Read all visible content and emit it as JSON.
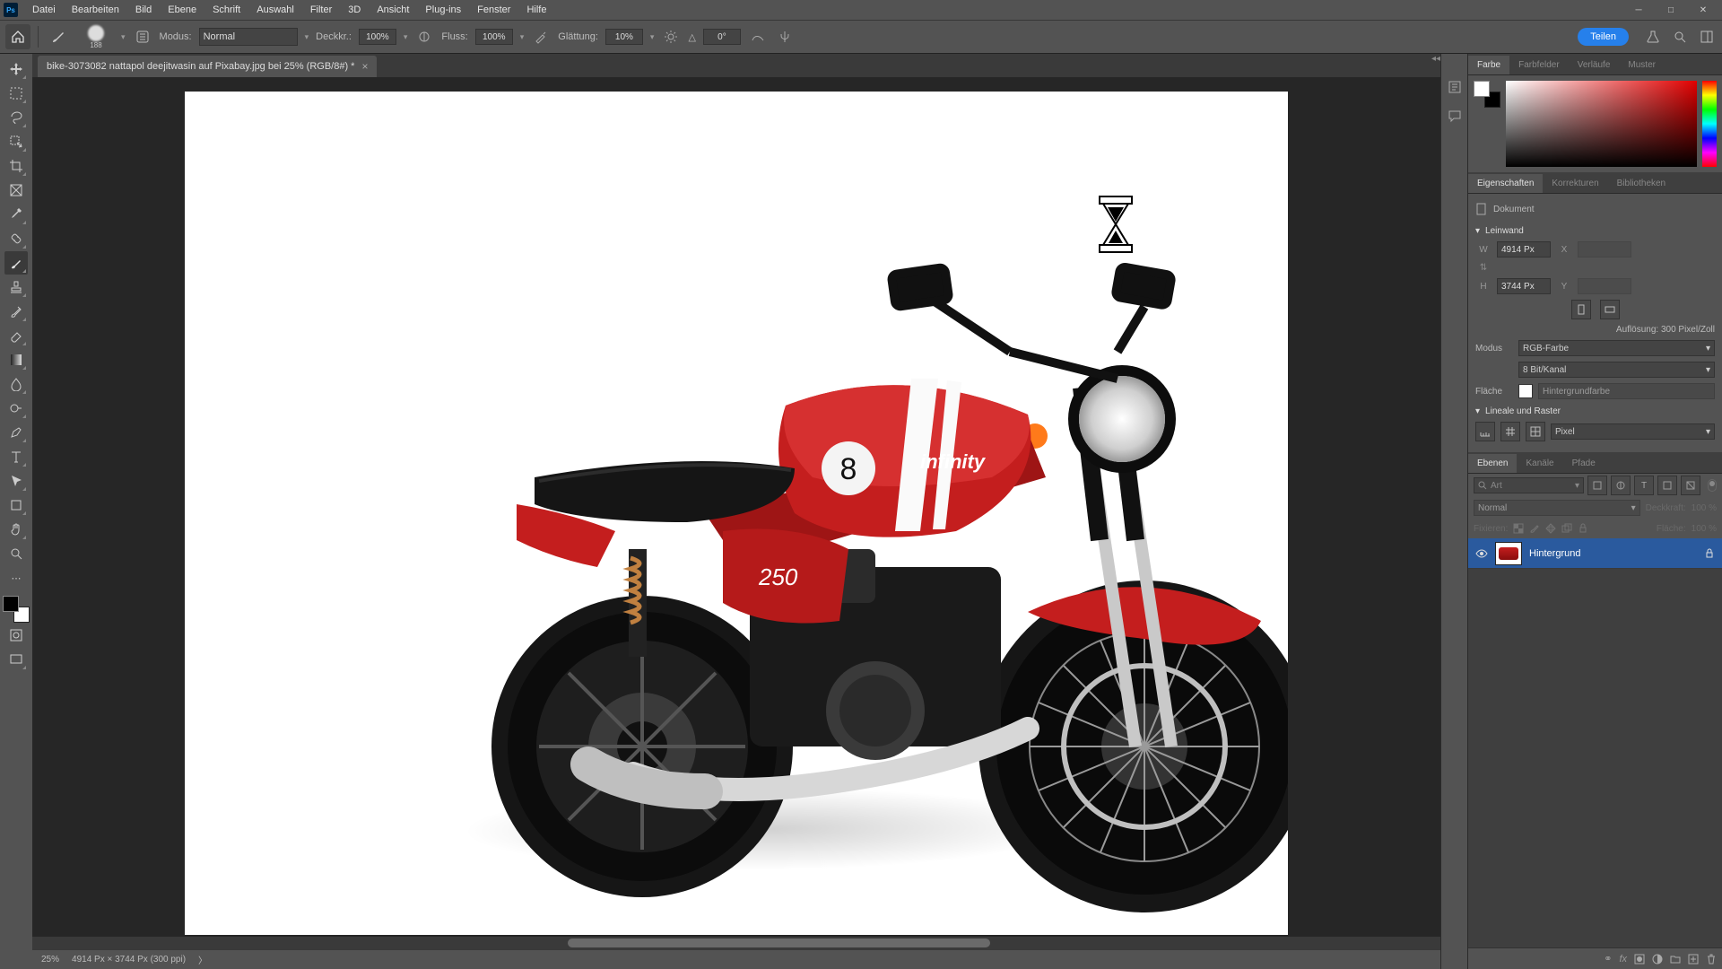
{
  "menu": {
    "items": [
      "Datei",
      "Bearbeiten",
      "Bild",
      "Ebene",
      "Schrift",
      "Auswahl",
      "Filter",
      "3D",
      "Ansicht",
      "Plug-ins",
      "Fenster",
      "Hilfe"
    ]
  },
  "options": {
    "brush_size": "188",
    "mode_label": "Modus:",
    "mode_value": "Normal",
    "opacity_label": "Deckkr.:",
    "opacity_value": "100%",
    "flow_label": "Fluss:",
    "flow_value": "100%",
    "smoothing_label": "Glättung:",
    "smoothing_value": "10%",
    "angle_icon": "△",
    "angle_value": "0°",
    "share": "Teilen"
  },
  "document": {
    "tab_title": "bike-3073082 nattapol deejitwasin auf Pixabay.jpg bei 25% (RGB/8#) *",
    "zoom": "25%",
    "status": "4914 Px × 3744 Px (300 ppi)"
  },
  "panels": {
    "color": {
      "tabs": [
        "Farbe",
        "Farbfelder",
        "Verläufe",
        "Muster"
      ],
      "active": 0
    },
    "properties": {
      "tabs": [
        "Eigenschaften",
        "Korrekturen",
        "Bibliotheken"
      ],
      "active": 0,
      "doc_label": "Dokument",
      "canvas_section": "Leinwand",
      "w_label": "W",
      "w_value": "4914 Px",
      "x_label": "X",
      "h_label": "H",
      "h_value": "3744 Px",
      "y_label": "Y",
      "resolution": "Auflösung: 300 Pixel/Zoll",
      "mode_label": "Modus",
      "mode_value": "RGB-Farbe",
      "depth_value": "8 Bit/Kanal",
      "fill_label": "Fläche",
      "fill_value": "Hintergrundfarbe",
      "rulers_section": "Lineale und Raster",
      "units": "Pixel"
    },
    "layers": {
      "tabs": [
        "Ebenen",
        "Kanäle",
        "Pfade"
      ],
      "active": 0,
      "filter_placeholder": "Art",
      "blend_mode": "Normal",
      "opacity_label": "Deckkraft:",
      "opacity_value": "100 %",
      "lock_label": "Fixieren:",
      "fill_label": "Fläche:",
      "fill_value": "100 %",
      "items": [
        {
          "name": "Hintergrund",
          "locked": true
        }
      ]
    }
  }
}
